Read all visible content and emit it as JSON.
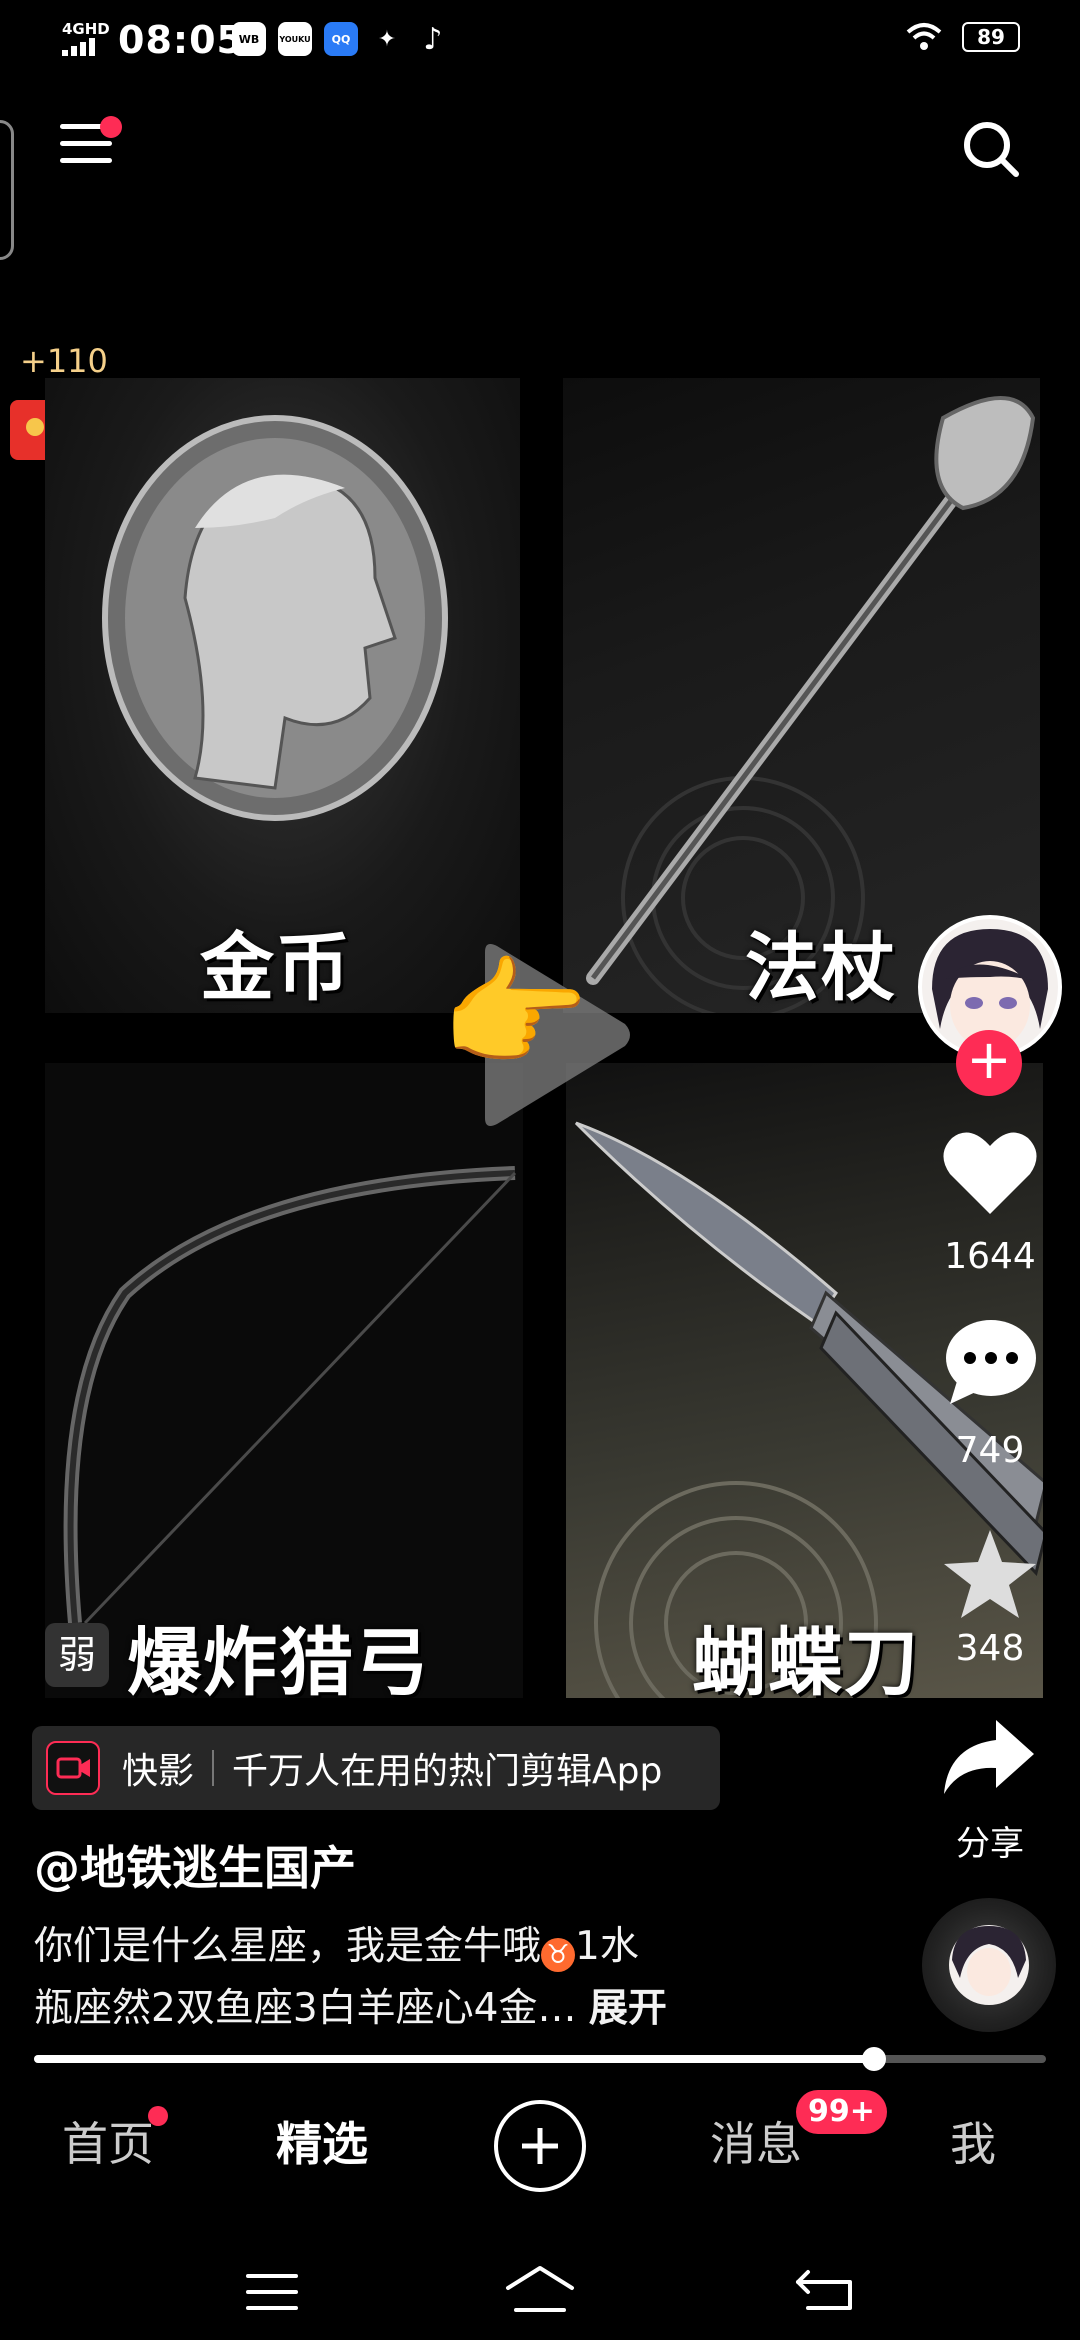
{
  "status_bar": {
    "network": "4GHD",
    "time": "08:05",
    "apps": [
      "WB",
      "YOUKU",
      "QQ",
      "✦",
      "♪"
    ],
    "battery": "89"
  },
  "coins": {
    "count": "+110"
  },
  "panels": [
    {
      "label": "金币"
    },
    {
      "label": "法杖"
    },
    {
      "label": "爆炸猎弓"
    },
    {
      "label": "蝴蝶刀"
    }
  ],
  "panel_watermark": "弱",
  "rail": {
    "likes": "1644",
    "comments": "749",
    "favorites": "348",
    "share_label": "分享"
  },
  "ad": {
    "name": "快影",
    "slogan": "千万人在用的热门剪辑App"
  },
  "author": "@地铁逃生国产",
  "description": {
    "line1_before": "你们是什么星座，我是金牛哦",
    "emoji": "♉",
    "line1_after": "1水",
    "line2": "瓶座然2双鱼座3白羊座心4金…",
    "more": "展开"
  },
  "progress": {
    "value": 0.83
  },
  "tabs": {
    "home": "首页",
    "featured": "精选",
    "messages": "消息",
    "messages_badge": "99+",
    "me": "我"
  },
  "colors": {
    "accent": "#fe2c55",
    "background": "#000000"
  }
}
